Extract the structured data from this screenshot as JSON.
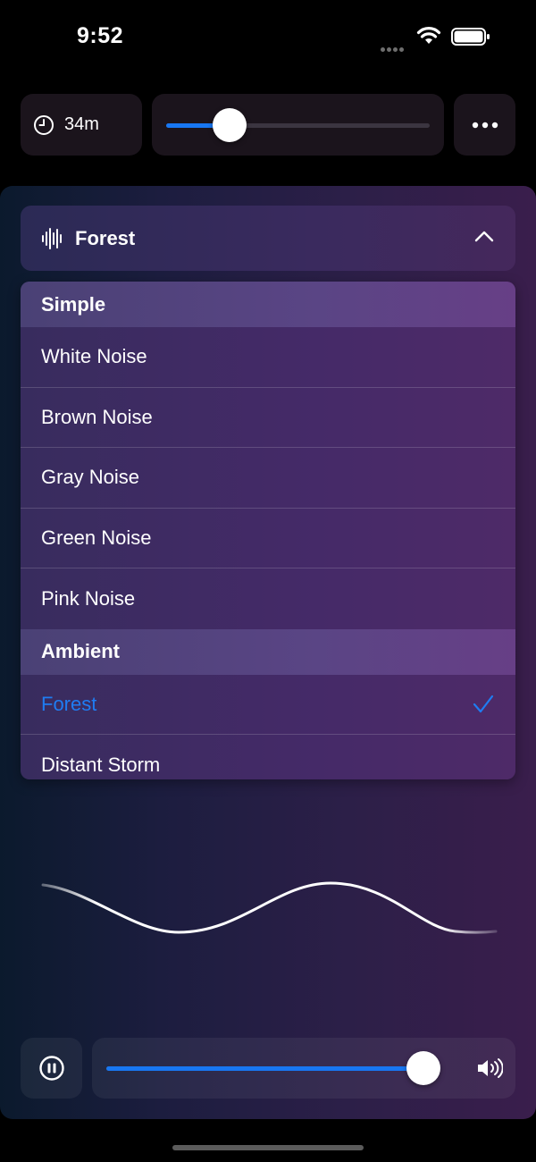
{
  "status_bar": {
    "time": "9:52"
  },
  "timer": {
    "label": "34m",
    "slider_value": 0.24
  },
  "sound_selector": {
    "current": "Forest",
    "sections": [
      {
        "title": "Simple",
        "items": [
          "White Noise",
          "Brown Noise",
          "Gray Noise",
          "Green Noise",
          "Pink Noise"
        ]
      },
      {
        "title": "Ambient",
        "items": [
          "Forest",
          "Distant Storm"
        ]
      }
    ],
    "selected_item": "Forest"
  },
  "playback": {
    "state": "playing",
    "volume": 0.95
  },
  "colors": {
    "accent": "#1877f2",
    "selected_text": "#1f7cf2",
    "card_bg": "#1b141c"
  }
}
